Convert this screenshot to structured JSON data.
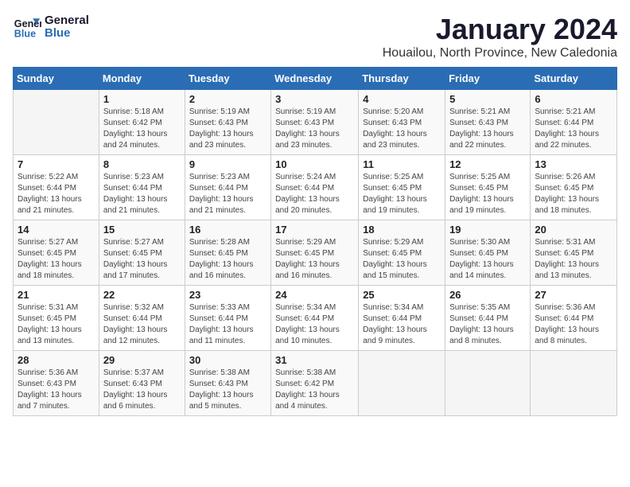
{
  "logo": {
    "line1": "General",
    "line2": "Blue"
  },
  "title": "January 2024",
  "subtitle": "Houailou, North Province, New Caledonia",
  "header": {
    "accent_color": "#2a6db5"
  },
  "weekdays": [
    "Sunday",
    "Monday",
    "Tuesday",
    "Wednesday",
    "Thursday",
    "Friday",
    "Saturday"
  ],
  "weeks": [
    [
      {
        "day": "",
        "sunrise": "",
        "sunset": "",
        "daylight": ""
      },
      {
        "day": "1",
        "sunrise": "Sunrise: 5:18 AM",
        "sunset": "Sunset: 6:42 PM",
        "daylight": "Daylight: 13 hours and 24 minutes."
      },
      {
        "day": "2",
        "sunrise": "Sunrise: 5:19 AM",
        "sunset": "Sunset: 6:43 PM",
        "daylight": "Daylight: 13 hours and 23 minutes."
      },
      {
        "day": "3",
        "sunrise": "Sunrise: 5:19 AM",
        "sunset": "Sunset: 6:43 PM",
        "daylight": "Daylight: 13 hours and 23 minutes."
      },
      {
        "day": "4",
        "sunrise": "Sunrise: 5:20 AM",
        "sunset": "Sunset: 6:43 PM",
        "daylight": "Daylight: 13 hours and 23 minutes."
      },
      {
        "day": "5",
        "sunrise": "Sunrise: 5:21 AM",
        "sunset": "Sunset: 6:43 PM",
        "daylight": "Daylight: 13 hours and 22 minutes."
      },
      {
        "day": "6",
        "sunrise": "Sunrise: 5:21 AM",
        "sunset": "Sunset: 6:44 PM",
        "daylight": "Daylight: 13 hours and 22 minutes."
      }
    ],
    [
      {
        "day": "7",
        "sunrise": "Sunrise: 5:22 AM",
        "sunset": "Sunset: 6:44 PM",
        "daylight": "Daylight: 13 hours and 21 minutes."
      },
      {
        "day": "8",
        "sunrise": "Sunrise: 5:23 AM",
        "sunset": "Sunset: 6:44 PM",
        "daylight": "Daylight: 13 hours and 21 minutes."
      },
      {
        "day": "9",
        "sunrise": "Sunrise: 5:23 AM",
        "sunset": "Sunset: 6:44 PM",
        "daylight": "Daylight: 13 hours and 21 minutes."
      },
      {
        "day": "10",
        "sunrise": "Sunrise: 5:24 AM",
        "sunset": "Sunset: 6:44 PM",
        "daylight": "Daylight: 13 hours and 20 minutes."
      },
      {
        "day": "11",
        "sunrise": "Sunrise: 5:25 AM",
        "sunset": "Sunset: 6:45 PM",
        "daylight": "Daylight: 13 hours and 19 minutes."
      },
      {
        "day": "12",
        "sunrise": "Sunrise: 5:25 AM",
        "sunset": "Sunset: 6:45 PM",
        "daylight": "Daylight: 13 hours and 19 minutes."
      },
      {
        "day": "13",
        "sunrise": "Sunrise: 5:26 AM",
        "sunset": "Sunset: 6:45 PM",
        "daylight": "Daylight: 13 hours and 18 minutes."
      }
    ],
    [
      {
        "day": "14",
        "sunrise": "Sunrise: 5:27 AM",
        "sunset": "Sunset: 6:45 PM",
        "daylight": "Daylight: 13 hours and 18 minutes."
      },
      {
        "day": "15",
        "sunrise": "Sunrise: 5:27 AM",
        "sunset": "Sunset: 6:45 PM",
        "daylight": "Daylight: 13 hours and 17 minutes."
      },
      {
        "day": "16",
        "sunrise": "Sunrise: 5:28 AM",
        "sunset": "Sunset: 6:45 PM",
        "daylight": "Daylight: 13 hours and 16 minutes."
      },
      {
        "day": "17",
        "sunrise": "Sunrise: 5:29 AM",
        "sunset": "Sunset: 6:45 PM",
        "daylight": "Daylight: 13 hours and 16 minutes."
      },
      {
        "day": "18",
        "sunrise": "Sunrise: 5:29 AM",
        "sunset": "Sunset: 6:45 PM",
        "daylight": "Daylight: 13 hours and 15 minutes."
      },
      {
        "day": "19",
        "sunrise": "Sunrise: 5:30 AM",
        "sunset": "Sunset: 6:45 PM",
        "daylight": "Daylight: 13 hours and 14 minutes."
      },
      {
        "day": "20",
        "sunrise": "Sunrise: 5:31 AM",
        "sunset": "Sunset: 6:45 PM",
        "daylight": "Daylight: 13 hours and 13 minutes."
      }
    ],
    [
      {
        "day": "21",
        "sunrise": "Sunrise: 5:31 AM",
        "sunset": "Sunset: 6:45 PM",
        "daylight": "Daylight: 13 hours and 13 minutes."
      },
      {
        "day": "22",
        "sunrise": "Sunrise: 5:32 AM",
        "sunset": "Sunset: 6:44 PM",
        "daylight": "Daylight: 13 hours and 12 minutes."
      },
      {
        "day": "23",
        "sunrise": "Sunrise: 5:33 AM",
        "sunset": "Sunset: 6:44 PM",
        "daylight": "Daylight: 13 hours and 11 minutes."
      },
      {
        "day": "24",
        "sunrise": "Sunrise: 5:34 AM",
        "sunset": "Sunset: 6:44 PM",
        "daylight": "Daylight: 13 hours and 10 minutes."
      },
      {
        "day": "25",
        "sunrise": "Sunrise: 5:34 AM",
        "sunset": "Sunset: 6:44 PM",
        "daylight": "Daylight: 13 hours and 9 minutes."
      },
      {
        "day": "26",
        "sunrise": "Sunrise: 5:35 AM",
        "sunset": "Sunset: 6:44 PM",
        "daylight": "Daylight: 13 hours and 8 minutes."
      },
      {
        "day": "27",
        "sunrise": "Sunrise: 5:36 AM",
        "sunset": "Sunset: 6:44 PM",
        "daylight": "Daylight: 13 hours and 8 minutes."
      }
    ],
    [
      {
        "day": "28",
        "sunrise": "Sunrise: 5:36 AM",
        "sunset": "Sunset: 6:43 PM",
        "daylight": "Daylight: 13 hours and 7 minutes."
      },
      {
        "day": "29",
        "sunrise": "Sunrise: 5:37 AM",
        "sunset": "Sunset: 6:43 PM",
        "daylight": "Daylight: 13 hours and 6 minutes."
      },
      {
        "day": "30",
        "sunrise": "Sunrise: 5:38 AM",
        "sunset": "Sunset: 6:43 PM",
        "daylight": "Daylight: 13 hours and 5 minutes."
      },
      {
        "day": "31",
        "sunrise": "Sunrise: 5:38 AM",
        "sunset": "Sunset: 6:42 PM",
        "daylight": "Daylight: 13 hours and 4 minutes."
      },
      {
        "day": "",
        "sunrise": "",
        "sunset": "",
        "daylight": ""
      },
      {
        "day": "",
        "sunrise": "",
        "sunset": "",
        "daylight": ""
      },
      {
        "day": "",
        "sunrise": "",
        "sunset": "",
        "daylight": ""
      }
    ]
  ]
}
